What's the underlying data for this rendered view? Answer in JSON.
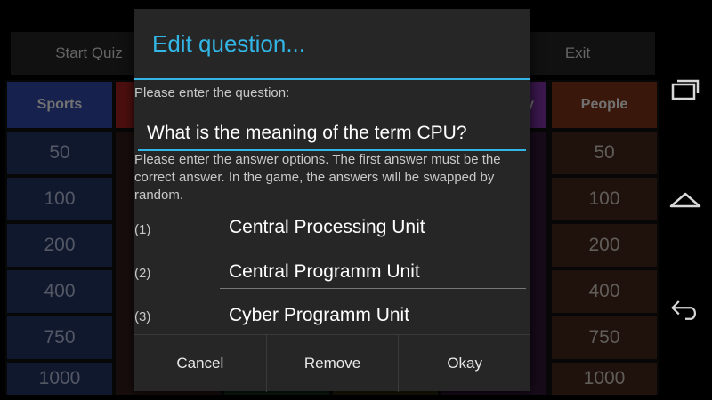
{
  "toolbar": {
    "start_label": "Start Quiz",
    "exit_label": "Exit"
  },
  "board": {
    "categories": [
      {
        "label": "Sports",
        "color": "#2a3d8f"
      },
      {
        "label": "",
        "color": "#8a1c1c"
      },
      {
        "label": "",
        "color": "#1d6b2a"
      },
      {
        "label": "",
        "color": "#7a6a1a"
      },
      {
        "label": "y",
        "color": "#6a2a8a"
      },
      {
        "label": "People",
        "color": "#6a2a14"
      }
    ],
    "col1_values": [
      "50",
      "100",
      "200",
      "400",
      "750",
      "1000"
    ],
    "col6_values": [
      "50",
      "100",
      "200",
      "400",
      "750",
      "1000"
    ]
  },
  "dialog": {
    "title": "Edit question...",
    "question_label": "Please enter the question:",
    "question_value": "What is the meaning of the term CPU?",
    "answers_label": "Please enter the answer options. The first answer must be the correct answer. In the game, the answers will be swapped by random.",
    "answers": [
      {
        "num": "(1)",
        "value": "Central Processing Unit"
      },
      {
        "num": "(2)",
        "value": "Central Programm Unit"
      },
      {
        "num": "(3)",
        "value": "Cyber Programm Unit"
      }
    ],
    "buttons": {
      "cancel": "Cancel",
      "remove": "Remove",
      "okay": "Okay"
    }
  },
  "colors": {
    "accent": "#33b5e5",
    "dialog_bg": "#262626",
    "spell_underline": "#e53935"
  },
  "nav_icons": [
    "recent-apps-icon",
    "home-icon",
    "back-icon"
  ]
}
